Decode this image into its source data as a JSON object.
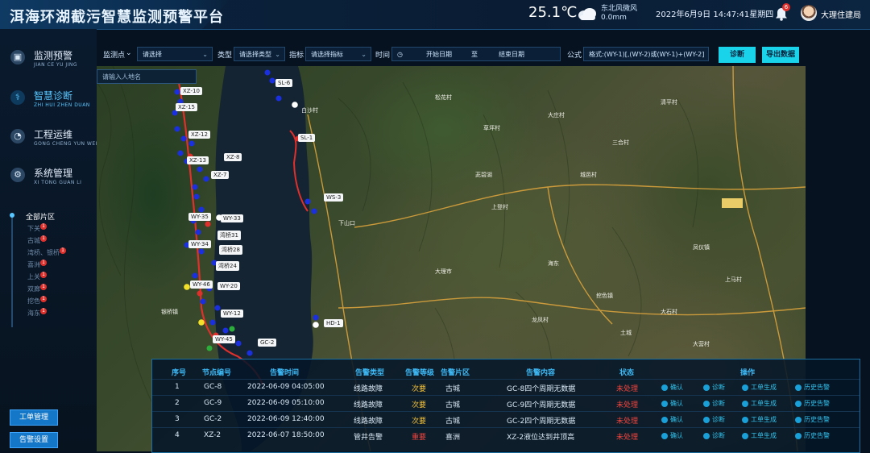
{
  "header": {
    "title": "洱海环湖截污智慧监测预警平台",
    "temperature": "25.1℃",
    "weather_icon": "cloud-icon",
    "wind": "东北风微风",
    "rain": "0.0mm",
    "datetime": "2022年6月9日  14:47:41星期四",
    "notifications": "6",
    "user": "大理住建局"
  },
  "sidebar": {
    "items": [
      {
        "label": "监测预警",
        "pinyin": "JIAN CE YU JING",
        "icon": "monitor-icon"
      },
      {
        "label": "智慧诊断",
        "pinyin": "ZHI HUI ZHEN DUAN",
        "icon": "stethoscope-icon"
      },
      {
        "label": "工程运维",
        "pinyin": "GONG CHENG YUN WEI",
        "icon": "dashboard-icon"
      },
      {
        "label": "系统管理",
        "pinyin": "XI TONG GUAN LI",
        "icon": "gear-icon"
      }
    ],
    "region_title": "全部片区",
    "regions": [
      {
        "label": "下关",
        "badge": "1"
      },
      {
        "label": "古城",
        "badge": "1"
      },
      {
        "label": "湾桥、银桥",
        "badge": "1"
      },
      {
        "label": "喜洲",
        "badge": "1"
      },
      {
        "label": "上关",
        "badge": "1"
      },
      {
        "label": "双廊",
        "badge": "1"
      },
      {
        "label": "挖色",
        "badge": "1"
      },
      {
        "label": "海东",
        "badge": "1"
      }
    ],
    "btn_workorder": "工单管理",
    "btn_alarm_settings": "告警设置"
  },
  "filters": {
    "monitor_point_label": "监测点",
    "monitor_point_value": "请选择",
    "type_label": "类型",
    "type_value": "请选择类型",
    "metric_label": "指标",
    "metric_value": "请选择指标",
    "time_label": "时间",
    "start_placeholder": "开始日期",
    "range_sep": "至",
    "end_placeholder": "结束日期",
    "formula_label": "公式",
    "formula_value": "格式:(WY-1)[,(WY-2)或(WY-1)+(WY-2]",
    "diagnose_btn": "诊断",
    "export_btn": "导出数据",
    "search_placeholder": "请输入人地名"
  },
  "map": {
    "node_labels": [
      "XZ-10",
      "XZ-15",
      "XZ-12",
      "XZ-13",
      "XZ-8",
      "XZ-7",
      "WY-35",
      "WY-33",
      "WY-34",
      "WY-46",
      "WY-20",
      "WY-12",
      "WY-45",
      "GC-2",
      "SL-6",
      "SL-1",
      "WS-3",
      "HD-1",
      "湾桥31",
      "湾桥28",
      "湾桥24"
    ],
    "place_labels": [
      "白沙村",
      "松花村",
      "草坪村",
      "大庄村",
      "三合村",
      "清平村",
      "城邑村",
      "茈碧湖",
      "下山口",
      "凤仪镇",
      "海东",
      "大理市",
      "挖色镇",
      "上登村",
      "银桥镇",
      "龙凤村",
      "大石村",
      "上马村",
      "土城",
      "大营村"
    ]
  },
  "alerts": {
    "headers": [
      "序号",
      "节点编号",
      "告警时间",
      "告警类型",
      "告警等级",
      "告警片区",
      "告警内容",
      "状态",
      "操作"
    ],
    "actions": [
      "确认",
      "诊断",
      "工单生成",
      "历史告警"
    ],
    "rows": [
      {
        "no": "1",
        "node": "GC-8",
        "time": "2022-06-09 04:05:00",
        "type": "线路故障",
        "level": "次要",
        "level_color": "yellow",
        "region": "古城",
        "content": "GC-8四个周期无数据",
        "status": "未处理"
      },
      {
        "no": "2",
        "node": "GC-9",
        "time": "2022-06-09 05:10:00",
        "type": "线路故障",
        "level": "次要",
        "level_color": "yellow",
        "region": "古城",
        "content": "GC-9四个周期无数据",
        "status": "未处理"
      },
      {
        "no": "3",
        "node": "GC-2",
        "time": "2022-06-09 12:40:00",
        "type": "线路故障",
        "level": "次要",
        "level_color": "yellow",
        "region": "古城",
        "content": "GC-2四个周期无数据",
        "status": "未处理"
      },
      {
        "no": "4",
        "node": "XZ-2",
        "time": "2022-06-07 18:50:00",
        "type": "管井告警",
        "level": "重要",
        "level_color": "red",
        "region": "喜洲",
        "content": "XZ-2液位达到井顶高",
        "status": "未处理"
      }
    ]
  },
  "colors": {
    "accent": "#58c7ff",
    "button_cyan": "#19d3ea",
    "alert_red": "#f0453f",
    "alert_yellow": "#f3c23a",
    "node_blue": "#1a2fe0",
    "node_red": "#e0302c",
    "node_yellow": "#f3e02a",
    "node_white": "#ffffff"
  }
}
